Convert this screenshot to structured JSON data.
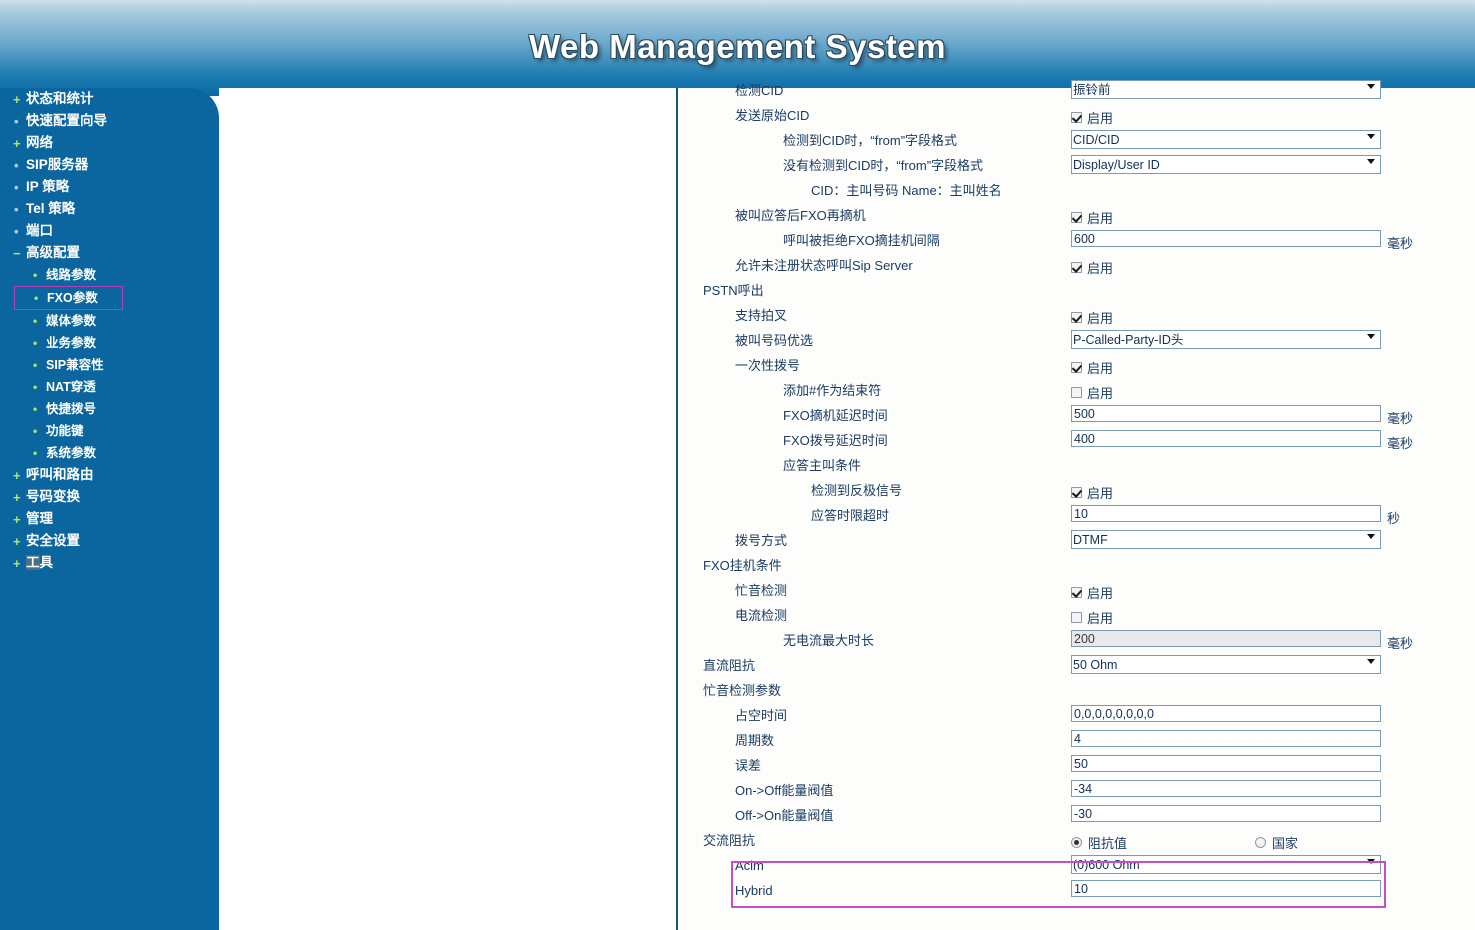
{
  "header": {
    "title": "Web Management System"
  },
  "sidebar": {
    "items": [
      {
        "label": "状态和统计",
        "toggle": "+",
        "type": "top"
      },
      {
        "label": "快速配置向导",
        "toggle": "•",
        "type": "top"
      },
      {
        "label": "网络",
        "toggle": "+",
        "type": "top"
      },
      {
        "label": "SIP服务器",
        "toggle": "•",
        "type": "top"
      },
      {
        "label": "IP 策略",
        "toggle": "•",
        "type": "top"
      },
      {
        "label": "Tel 策略",
        "toggle": "•",
        "type": "top"
      },
      {
        "label": "端口",
        "toggle": "•",
        "type": "top"
      },
      {
        "label": "高级配置",
        "toggle": "−",
        "type": "top"
      },
      {
        "label": "线路参数",
        "toggle": "•",
        "type": "sub"
      },
      {
        "label": "FXO参数",
        "toggle": "•",
        "type": "sub",
        "selected": true
      },
      {
        "label": "媒体参数",
        "toggle": "•",
        "type": "sub"
      },
      {
        "label": "业务参数",
        "toggle": "•",
        "type": "sub"
      },
      {
        "label": "SIP兼容性",
        "toggle": "•",
        "type": "sub"
      },
      {
        "label": "NAT穿透",
        "toggle": "•",
        "type": "sub"
      },
      {
        "label": "快捷拨号",
        "toggle": "•",
        "type": "sub"
      },
      {
        "label": "功能键",
        "toggle": "•",
        "type": "sub"
      },
      {
        "label": "系统参数",
        "toggle": "•",
        "type": "sub"
      },
      {
        "label": "呼叫和路由",
        "toggle": "+",
        "type": "top"
      },
      {
        "label": "号码变换",
        "toggle": "+",
        "type": "top"
      },
      {
        "label": "管理",
        "toggle": "+",
        "type": "top"
      },
      {
        "label": "安全设置",
        "toggle": "+",
        "type": "top"
      },
      {
        "label": "工具",
        "toggle": "+",
        "type": "top"
      }
    ],
    "accent_color": "#0b66a0",
    "selected_outline_color": "#b83fb8"
  },
  "common": {
    "enable_label": "启用",
    "unit_ms": "毫秒",
    "unit_s": "秒"
  },
  "form": {
    "rows": [
      {
        "id": "detect-cid",
        "label": "检测CID",
        "indent": 1,
        "control": "select",
        "value": "振铃前",
        "cut": true
      },
      {
        "id": "send-original-cid",
        "label": "发送原始CID",
        "indent": 1,
        "control": "checkbox",
        "checked": true
      },
      {
        "id": "from-format-with-cid",
        "label": "检测到CID时，“from”字段格式",
        "indent": 2,
        "control": "select",
        "value": "CID/CID"
      },
      {
        "id": "from-format-no-cid",
        "label": "没有检测到CID时，“from”字段格式",
        "indent": 2,
        "control": "select",
        "value": "Display/User ID"
      },
      {
        "id": "cid-name-note",
        "label": "CID：主叫号码     Name：主叫姓名",
        "indent": 3,
        "control": "none"
      },
      {
        "id": "fxo-offhook-after-answer",
        "label": "被叫应答后FXO再摘机",
        "indent": 1,
        "control": "checkbox",
        "checked": true
      },
      {
        "id": "rejected-onoff-interval",
        "label": "呼叫被拒绝FXO摘挂机间隔",
        "indent": 2,
        "control": "text",
        "value": "600",
        "unit": "毫秒"
      },
      {
        "id": "allow-unregistered-call",
        "label": "允许未注册状态呼叫Sip Server",
        "indent": 1,
        "control": "checkbox",
        "checked": true
      },
      {
        "id": "pstn-out-group",
        "label": "PSTN呼出",
        "indent": 0,
        "control": "none"
      },
      {
        "id": "support-flash",
        "label": "支持拍叉",
        "indent": 1,
        "control": "checkbox",
        "checked": true
      },
      {
        "id": "called-number-preference",
        "label": "被叫号码优选",
        "indent": 1,
        "control": "select",
        "value": "P-Called-Party-ID头"
      },
      {
        "id": "one-stage-dial",
        "label": "一次性拨号",
        "indent": 1,
        "control": "checkbox",
        "checked": true
      },
      {
        "id": "add-hash-terminator",
        "label": "添加#作为结束符",
        "indent": 2,
        "control": "checkbox",
        "checked": false
      },
      {
        "id": "fxo-offhook-delay",
        "label": "FXO摘机延迟时间",
        "indent": 2,
        "control": "text",
        "value": "500",
        "unit": "毫秒"
      },
      {
        "id": "fxo-dial-delay",
        "label": "FXO拨号延迟时间",
        "indent": 2,
        "control": "text",
        "value": "400",
        "unit": "毫秒"
      },
      {
        "id": "answer-caller-condition",
        "label": "应答主叫条件",
        "indent": 2,
        "control": "none"
      },
      {
        "id": "detect-polarity-reversal",
        "label": "检测到反极信号",
        "indent": 3,
        "control": "checkbox",
        "checked": true
      },
      {
        "id": "answer-timeout",
        "label": "应答时限超时",
        "indent": 3,
        "control": "text",
        "value": "10",
        "unit": "秒"
      },
      {
        "id": "dial-mode",
        "label": "拨号方式",
        "indent": 1,
        "control": "select",
        "value": "DTMF"
      },
      {
        "id": "fxo-hangup-group",
        "label": "FXO挂机条件",
        "indent": 0,
        "control": "none"
      },
      {
        "id": "busy-tone-detect",
        "label": "忙音检测",
        "indent": 1,
        "control": "checkbox",
        "checked": true
      },
      {
        "id": "current-detect",
        "label": "电流检测",
        "indent": 1,
        "control": "checkbox",
        "checked": false
      },
      {
        "id": "no-current-max-duration",
        "label": "无电流最大时长",
        "indent": 2,
        "control": "text",
        "value": "200",
        "unit": "毫秒",
        "disabled": true
      },
      {
        "id": "dc-impedance",
        "label": "直流阻抗",
        "indent": 0,
        "control": "select",
        "value": "50 Ohm"
      },
      {
        "id": "busy-tone-params-group",
        "label": "忙音检测参数",
        "indent": 0,
        "control": "none"
      },
      {
        "id": "duty-time",
        "label": "占空时间",
        "indent": 1,
        "control": "text",
        "value": "0,0,0,0,0,0,0,0"
      },
      {
        "id": "cycle-count",
        "label": "周期数",
        "indent": 1,
        "control": "text",
        "value": "4"
      },
      {
        "id": "tolerance",
        "label": "误差",
        "indent": 1,
        "control": "text",
        "value": "50"
      },
      {
        "id": "on-off-threshold",
        "label": "On->Off能量阀值",
        "indent": 1,
        "control": "text",
        "value": "-34"
      },
      {
        "id": "off-on-threshold",
        "label": "Off->On能量阀值",
        "indent": 1,
        "control": "text",
        "value": "-30"
      },
      {
        "id": "ac-impedance",
        "label": "交流阻抗",
        "indent": 0,
        "control": "radio",
        "radios": [
          {
            "label": "阻抗值",
            "checked": true
          },
          {
            "label": "国家",
            "checked": false
          }
        ]
      },
      {
        "id": "acim",
        "label": "Acim",
        "indent": 1,
        "control": "select",
        "value": "(0)600 Ohm",
        "highlight": true
      },
      {
        "id": "hybrid",
        "label": "Hybrid",
        "indent": 1,
        "control": "text",
        "value": "10",
        "highlight": true
      }
    ]
  }
}
